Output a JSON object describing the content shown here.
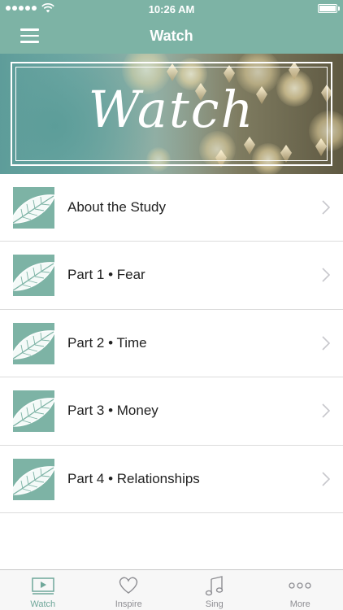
{
  "status_bar": {
    "time": "10:26 AM",
    "signal_bars": 5
  },
  "nav": {
    "title": "Watch",
    "menu_icon": "hamburger-icon"
  },
  "hero": {
    "title": "Watch"
  },
  "items": [
    {
      "label": "About the Study"
    },
    {
      "label": "Part 1 • Fear"
    },
    {
      "label": "Part 2 • Time"
    },
    {
      "label": "Part 3 • Money"
    },
    {
      "label": "Part 4 • Relationships"
    }
  ],
  "tabs": [
    {
      "label": "Watch",
      "icon": "video-icon",
      "active": true
    },
    {
      "label": "Inspire",
      "icon": "heart-icon",
      "active": false
    },
    {
      "label": "Sing",
      "icon": "music-note-icon",
      "active": false
    },
    {
      "label": "More",
      "icon": "more-icon",
      "active": false
    }
  ],
  "colors": {
    "accent": "#7db3a5",
    "active_tab": "#6fa79a",
    "inactive_tab": "#8e8e93"
  }
}
